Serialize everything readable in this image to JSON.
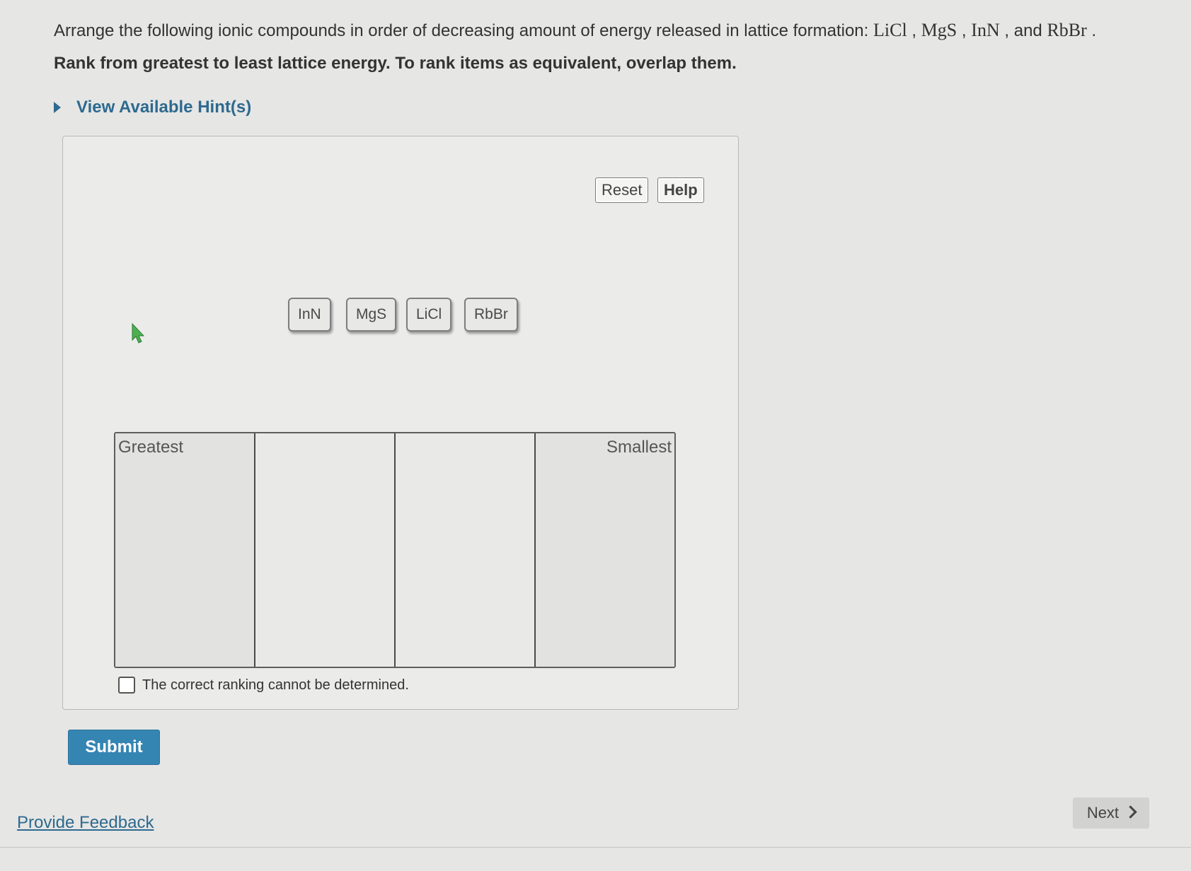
{
  "question": {
    "prefix": "Arrange the following ionic compounds in order of decreasing amount of energy released in lattice formation: ",
    "compounds": [
      "LiCl",
      "MgS",
      "InN",
      "RbBr"
    ],
    "sep1": " , ",
    "sep2": " , ",
    "sep3": " , and ",
    "end": " ."
  },
  "instruction": "Rank from greatest to least lattice energy. To rank items as equivalent, overlap them.",
  "hint": {
    "label": "View Available Hint(s)"
  },
  "toolbar": {
    "reset_label": "Reset",
    "help_label": "Help"
  },
  "tiles": [
    "InN",
    "MgS",
    "LiCl",
    "RbBr"
  ],
  "ranking": {
    "greatest_label": "Greatest",
    "smallest_label": "Smallest"
  },
  "checkbox": {
    "label": "The correct ranking cannot be determined."
  },
  "submit_label": "Submit",
  "feedback_label": "Provide Feedback",
  "next_label": "Next",
  "colors": {
    "accent": "#2d6a8f",
    "submit": "#3585b3",
    "pointer": "#4caf50"
  }
}
